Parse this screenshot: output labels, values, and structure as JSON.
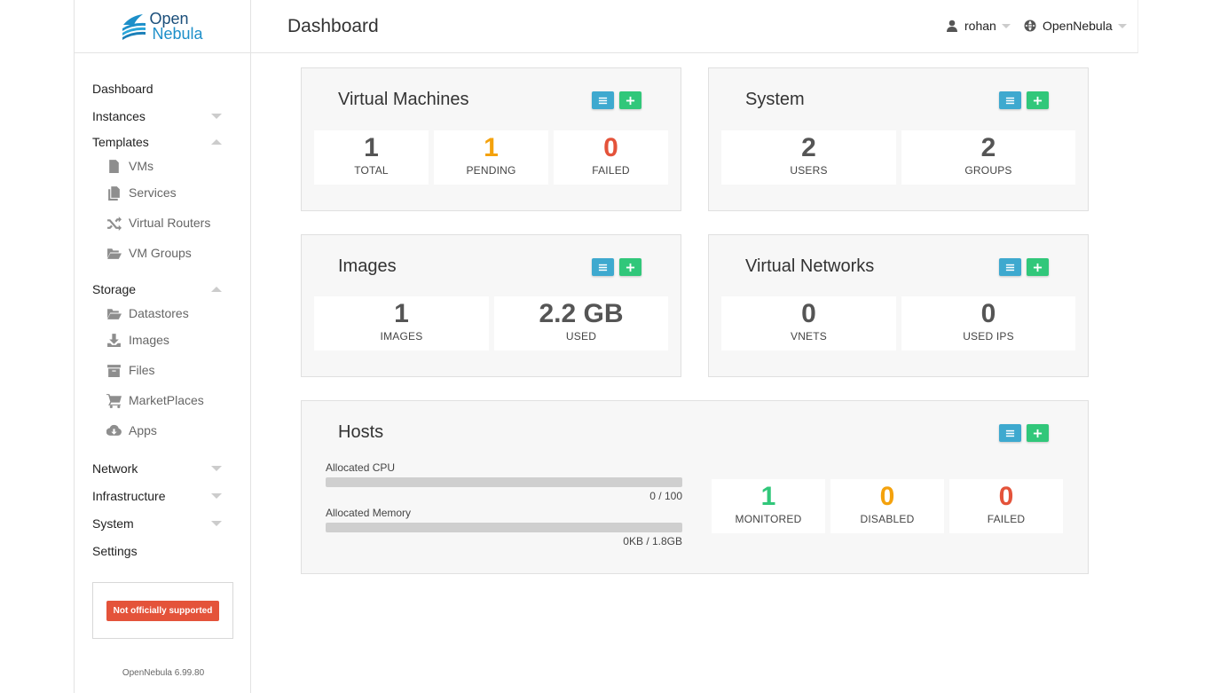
{
  "brand": {
    "line1": "Open",
    "line2": "Nebula"
  },
  "header": {
    "title": "Dashboard",
    "user": "rohan",
    "zone": "OpenNebula"
  },
  "sidebar": {
    "items": [
      {
        "label": "Dashboard"
      },
      {
        "label": "Instances"
      },
      {
        "label": "Templates",
        "sub": [
          "VMs",
          "Services",
          "Virtual Routers",
          "VM Groups"
        ]
      },
      {
        "label": "Storage",
        "sub": [
          "Datastores",
          "Images",
          "Files",
          "MarketPlaces",
          "Apps"
        ]
      },
      {
        "label": "Network"
      },
      {
        "label": "Infrastructure"
      },
      {
        "label": "System"
      },
      {
        "label": "Settings"
      }
    ],
    "support_badge": "Not officially supported",
    "version": "OpenNebula 6.99.80"
  },
  "panels": {
    "vms": {
      "title": "Virtual Machines",
      "stats": [
        {
          "value": "1",
          "label": "TOTAL"
        },
        {
          "value": "1",
          "label": "PENDING"
        },
        {
          "value": "0",
          "label": "FAILED"
        }
      ]
    },
    "system": {
      "title": "System",
      "stats": [
        {
          "value": "2",
          "label": "USERS"
        },
        {
          "value": "2",
          "label": "GROUPS"
        }
      ]
    },
    "images": {
      "title": "Images",
      "stats": [
        {
          "value": "1",
          "label": "IMAGES"
        },
        {
          "value": "2.2 GB",
          "label": "USED"
        }
      ]
    },
    "vnets": {
      "title": "Virtual Networks",
      "stats": [
        {
          "value": "0",
          "label": "VNETS"
        },
        {
          "value": "0",
          "label": "USED IPS"
        }
      ]
    },
    "hosts": {
      "title": "Hosts",
      "cpu_label": "Allocated CPU",
      "cpu_value": "0 / 100",
      "cpu_fraction": 0,
      "mem_label": "Allocated Memory",
      "mem_value": "0KB / 1.8GB",
      "mem_fraction": 0,
      "stats": [
        {
          "value": "1",
          "label": "MONITORED"
        },
        {
          "value": "0",
          "label": "DISABLED"
        },
        {
          "value": "0",
          "label": "FAILED"
        }
      ]
    }
  },
  "colors": {
    "accent_blue": "#3ea9cf",
    "accent_green": "#31c77a",
    "warning": "#f4a20d",
    "danger": "#e4533a"
  },
  "icons": {
    "list_button": "list-icon",
    "add_button": "plus-icon"
  }
}
